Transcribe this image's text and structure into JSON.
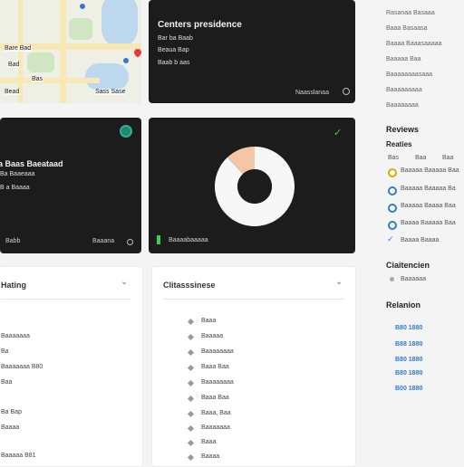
{
  "map": {
    "labels": [
      "Bare Bad",
      "Bad",
      "Bas",
      "Bead",
      "Sass Sase"
    ]
  },
  "top_card": {
    "title": "Centers presidence",
    "lines": [
      "Bar ba Baab",
      "Beaua Bap",
      "Baab b aas"
    ],
    "footer": "Naasslanaa"
  },
  "mid_card": {
    "title": "a Baas Baeataad",
    "lines": [
      "Ba Baaeaaa",
      "B a Baaaa"
    ],
    "footer_left": "Babb",
    "footer_right": "Baaana"
  },
  "donut_card": {
    "label": "Baaaabaaaaa",
    "chart_data": {
      "type": "pie",
      "slices": [
        {
          "value": 88,
          "color": "#f7f7f7"
        },
        {
          "value": 12,
          "color": "#f4c6a6"
        }
      ]
    }
  },
  "sidebar": {
    "items": [
      "Rasanaa Basaaa",
      "Baaa Basaasa",
      "Baaaa Baaasaaaaa",
      "Baaaaa Baa",
      "Baaaaaaaasaaa",
      "Baaaaaaaaa",
      "Baaaaaaaa"
    ],
    "reviews_title": "Reviews",
    "reviews_sub": "Reaties",
    "rev_cols": [
      "Bas",
      "Baa",
      "Baa"
    ],
    "reviews": [
      "Baaaaa Baaaaa Baa",
      "Baaaaa Baaaaa Ba",
      "Baaaaa Baaaa Baa",
      "Baaaa Baaaaa Baa",
      "Baaaa Baaaa"
    ],
    "attention_title": "Ciaitencien",
    "attention_item": "Baaaaaa",
    "relation_title": "Relanion",
    "links": [
      "B80 1880",
      "B88 1880",
      "B80 1880",
      "B80 1880",
      "B00 1880"
    ]
  },
  "left_panel": {
    "title": "Hating",
    "items": [
      "Baaaaaaa",
      "Ba",
      "Baaaaaaa B80",
      "Baa",
      "Ba Bap",
      "Baaaa",
      "Baaaaa B81"
    ]
  },
  "center_panel": {
    "title": "Clitasssinese",
    "items": [
      "Baaa",
      "Baaaaa",
      "Baaaaaaaa",
      "Baaa Baa",
      "Baaaaaaaa",
      "Baaa Baa",
      "Baaa, Baa",
      "Baaaaaaa",
      "Baaa",
      "Baaaa"
    ]
  },
  "colors": {
    "dark_card": "#1c1c1c",
    "accent_teal": "#1f8a70",
    "accent_green": "#3ccf4e",
    "blue": "#2f7bd8"
  }
}
